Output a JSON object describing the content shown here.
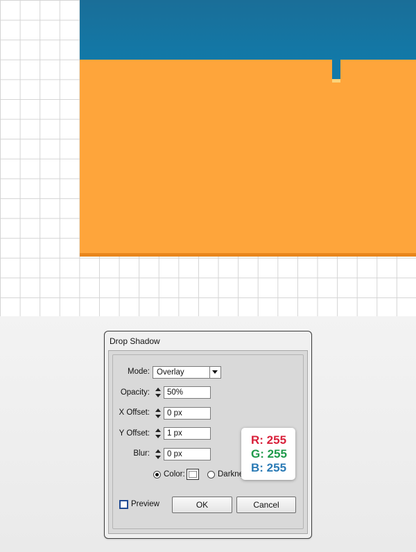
{
  "dialog": {
    "title": "Drop Shadow",
    "mode": {
      "label": "Mode:",
      "value": "Overlay"
    },
    "opacity": {
      "label": "Opacity:",
      "value": "50%"
    },
    "x_offset": {
      "label": "X Offset:",
      "value": "0 px"
    },
    "y_offset": {
      "label": "Y Offset:",
      "value": "1 px"
    },
    "blur": {
      "label": "Blur:",
      "value": "0 px"
    },
    "color_option": {
      "label": "Color:",
      "selected": true,
      "swatch_color": "#ffffff"
    },
    "darkness_option": {
      "label": "Darkne",
      "selected": false
    },
    "preview": {
      "label": "Preview",
      "checked": false
    },
    "ok_label": "OK",
    "cancel_label": "Cancel"
  },
  "rgb_callout": {
    "r": "R: 255",
    "g": "G: 255",
    "b": "B: 255",
    "r_color": "#d8203a",
    "g_color": "#1f9a4a",
    "b_color": "#2a7ab5"
  },
  "artwork": {
    "blue_color": "#1279a8",
    "orange_color": "#fea53b",
    "orange_edge_color": "#e8861c",
    "highlight_color": "#fbd37a"
  }
}
